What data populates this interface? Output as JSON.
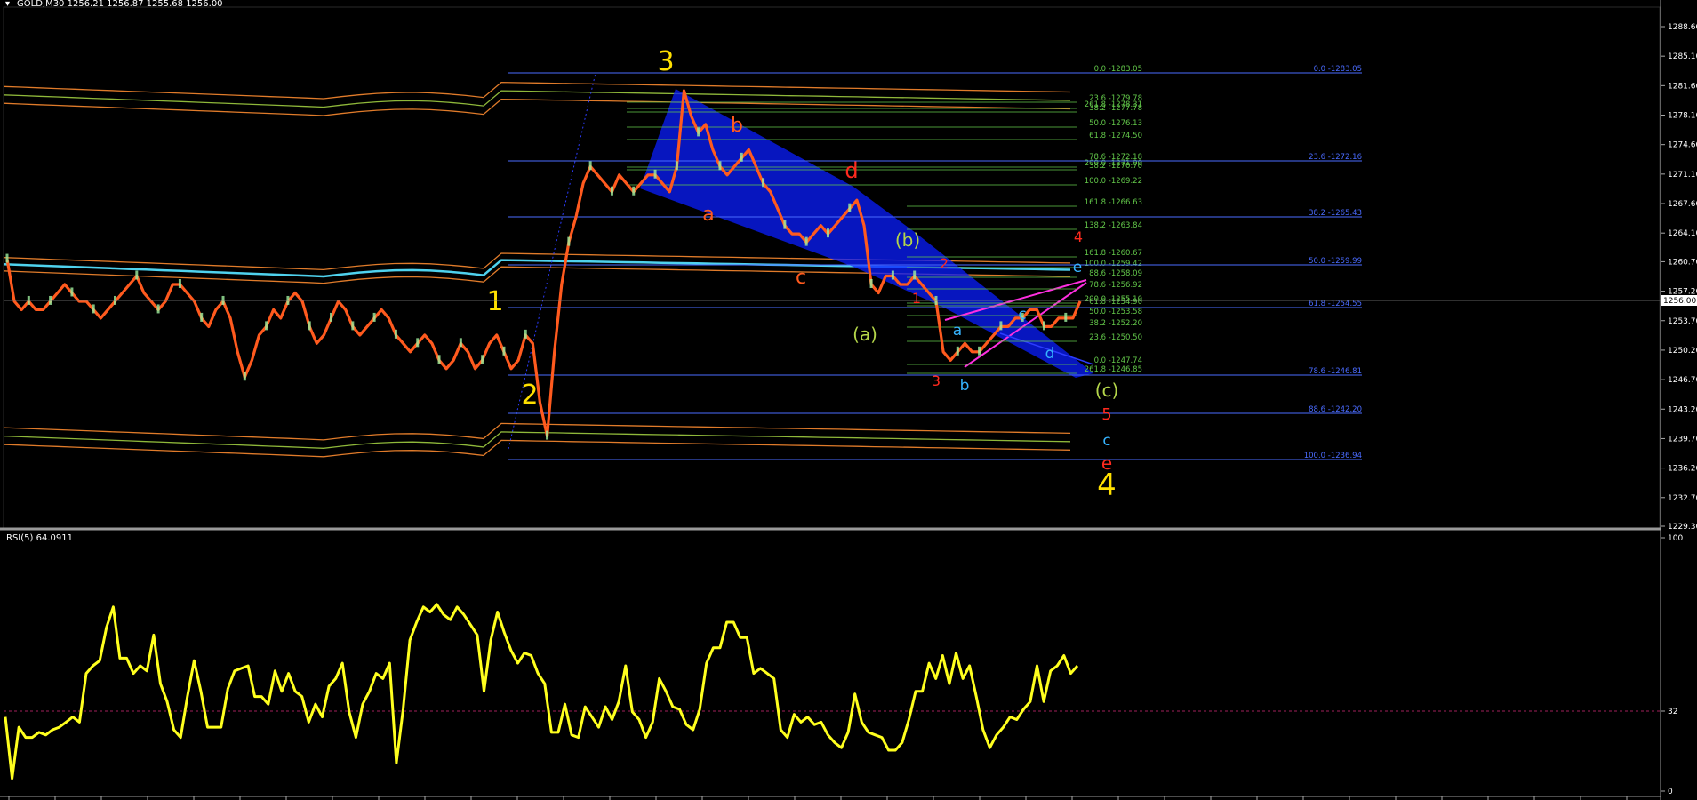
{
  "header": {
    "symbol_line": "GOLD,M30  1256.21 1256.87 1255.68 1256.00",
    "rsi_line": "RSI(5) 64.0911"
  },
  "colors": {
    "candle_line": "#ff5a1e",
    "fib_blue": "#4a6bff",
    "fib_green": "#63c84a",
    "rsi": "#ffff1e",
    "triangle": "#ff2ee0",
    "channel_blue": "#0a1eff"
  },
  "price_axis": {
    "ticks": [
      "1288.60",
      "1285.10",
      "1281.60",
      "1278.10",
      "1274.60",
      "1271.10",
      "1267.60",
      "1264.10",
      "1260.70",
      "1257.20",
      "1253.70",
      "1250.20",
      "1246.70",
      "1243.20",
      "1239.70",
      "1236.20",
      "1232.70",
      "1229.30"
    ],
    "current_price": "1256.00"
  },
  "rsi_axis": {
    "ticks": [
      "100",
      "32",
      "0"
    ],
    "level": 32
  },
  "wave_labels": {
    "yellow": [
      "1",
      "2",
      "3",
      "4"
    ],
    "orange": [
      "a",
      "b",
      "c"
    ],
    "red": [
      "d",
      "e"
    ],
    "green": [
      "(a)",
      "(b)",
      "(c)"
    ],
    "red_numbers": [
      "1",
      "2",
      "3",
      "4",
      "5"
    ],
    "cyan": [
      "a",
      "b",
      "c",
      "d",
      "e",
      "c"
    ]
  },
  "fib_green_labels": [
    "0.0 -1283.05",
    "23.6 -1279.78",
    "261.8 -1278.31",
    "38.2 -1277.78",
    "50.0 -1276.13",
    "61.8 -1274.50",
    "78.6 -1272.18",
    "200.0 -1271.00",
    "38.2 -1270.70",
    "100.0 -1269.22",
    "161.8 -1266.63",
    "138.2 -1263.84",
    "161.8 -1260.67",
    "100.0 -1259.42",
    "88.6 -1258.09",
    "78.6 -1256.92",
    "200.0 -1255.10",
    "61.8 -1254.90",
    "50.0 -1253.58",
    "38.2 -1252.20",
    "23.6 -1250.50",
    "0.0 -1247.74",
    "261.8 -1246.85"
  ],
  "fib_blue_labels": [
    "0.0 -1283.05",
    "23.6 -1272.16",
    "38.2 -1265.43",
    "50.0 -1259.99",
    "61.8 -1254.55",
    "78.6 -1246.81",
    "88.6 -1242.20",
    "100.0 -1236.94"
  ],
  "chart_data": {
    "type": "line",
    "title": "GOLD,M30",
    "price_range": [
      1229.3,
      1290.0
    ],
    "rsi_range": [
      0,
      100
    ],
    "close": [
      1261,
      1256,
      1255,
      1256,
      1255,
      1255,
      1256,
      1257,
      1258,
      1257,
      1256,
      1256,
      1255,
      1254,
      1255,
      1256,
      1257,
      1258,
      1259,
      1257,
      1256,
      1255,
      1256,
      1258,
      1258,
      1257,
      1256,
      1254,
      1253,
      1255,
      1256,
      1254,
      1250,
      1247,
      1249,
      1252,
      1253,
      1255,
      1254,
      1256,
      1257,
      1256,
      1253,
      1251,
      1252,
      1254,
      1256,
      1255,
      1253,
      1252,
      1253,
      1254,
      1255,
      1254,
      1252,
      1251,
      1250,
      1251,
      1252,
      1251,
      1249,
      1248,
      1249,
      1251,
      1250,
      1248,
      1249,
      1251,
      1252,
      1250,
      1248,
      1249,
      1252,
      1251,
      1244,
      1240,
      1250,
      1258,
      1263,
      1266,
      1270,
      1272,
      1271,
      1270,
      1269,
      1271,
      1270,
      1269,
      1270,
      1271,
      1271,
      1270,
      1269,
      1272,
      1281,
      1278,
      1276,
      1277,
      1274,
      1272,
      1271,
      1272,
      1273,
      1274,
      1272,
      1270,
      1269,
      1267,
      1265,
      1264,
      1264,
      1263,
      1264,
      1265,
      1264,
      1265,
      1266,
      1267,
      1268,
      1265,
      1258,
      1257,
      1259,
      1259,
      1258,
      1258,
      1259,
      1258,
      1257,
      1256,
      1250,
      1249,
      1250,
      1251,
      1250,
      1250,
      1251,
      1252,
      1253,
      1253,
      1254,
      1254,
      1255,
      1255,
      1253,
      1253,
      1254,
      1254,
      1254,
      1256
    ],
    "rsi": [
      30,
      6,
      26,
      22,
      22,
      24,
      23,
      25,
      26,
      28,
      30,
      28,
      47,
      50,
      52,
      65,
      73,
      53,
      53,
      47,
      50,
      48,
      62,
      43,
      36,
      25,
      22,
      38,
      52,
      40,
      26,
      26,
      26,
      41,
      48,
      49,
      50,
      38,
      38,
      35,
      48,
      40,
      47,
      40,
      38,
      28,
      35,
      30,
      42,
      45,
      51,
      32,
      22,
      35,
      40,
      47,
      45,
      51,
      12,
      33,
      60,
      67,
      73,
      71,
      74,
      70,
      68,
      73,
      70,
      66,
      62,
      40,
      60,
      71,
      63,
      56,
      51,
      55,
      54,
      47,
      43,
      24,
      24,
      35,
      23,
      22,
      34,
      30,
      26,
      34,
      29,
      36,
      50,
      32,
      29,
      22,
      28,
      45,
      40,
      34,
      33,
      27,
      25,
      33,
      51,
      57,
      57,
      67,
      67,
      61,
      61,
      47,
      49,
      47,
      45,
      25,
      22,
      31,
      28,
      30,
      27,
      28,
      23,
      20,
      18,
      24,
      39,
      28,
      24,
      23,
      22,
      17,
      17,
      20,
      29,
      40,
      40,
      51,
      45,
      54,
      43,
      55,
      45,
      50,
      38,
      25,
      18,
      23,
      26,
      30,
      29,
      33,
      36,
      50,
      36,
      48,
      50,
      54,
      47,
      50
    ]
  }
}
